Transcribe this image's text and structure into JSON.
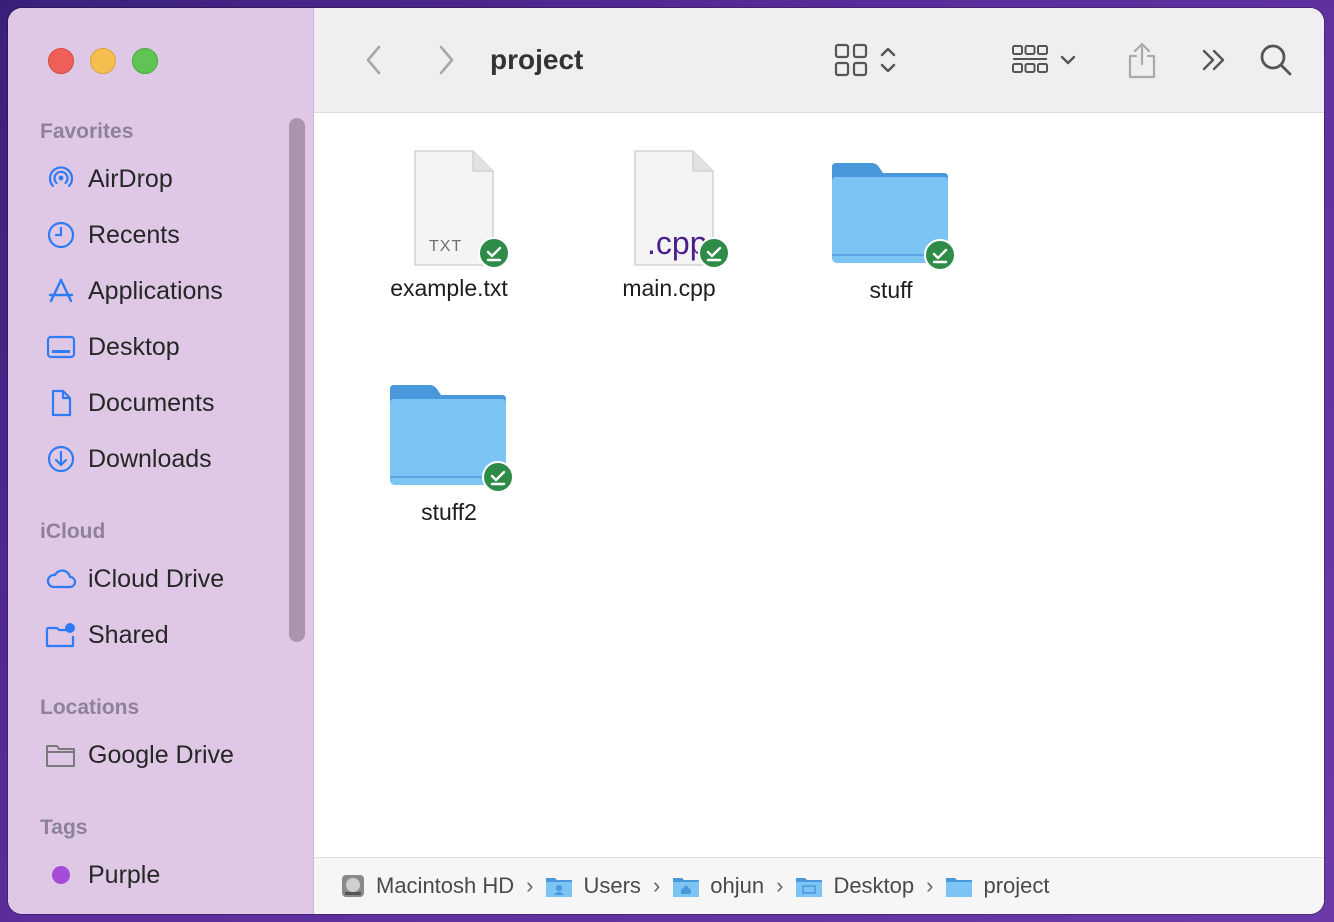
{
  "window": {
    "title": "project"
  },
  "sidebar": {
    "sections": [
      {
        "title": "Favorites"
      },
      {
        "title": "iCloud"
      },
      {
        "title": "Locations"
      },
      {
        "title": "Tags"
      }
    ],
    "favorites": [
      {
        "label": "AirDrop",
        "icon": "airdrop-icon"
      },
      {
        "label": "Recents",
        "icon": "clock-icon"
      },
      {
        "label": "Applications",
        "icon": "applications-icon"
      },
      {
        "label": "Desktop",
        "icon": "desktop-icon"
      },
      {
        "label": "Documents",
        "icon": "document-icon"
      },
      {
        "label": "Downloads",
        "icon": "download-icon"
      }
    ],
    "icloud": [
      {
        "label": "iCloud Drive",
        "icon": "cloud-icon"
      },
      {
        "label": "Shared",
        "icon": "shared-folder-icon"
      }
    ],
    "locations": [
      {
        "label": "Google Drive",
        "icon": "folder-outline-icon"
      }
    ],
    "tags": [
      {
        "label": "Purple",
        "color": "#a64ad8"
      }
    ]
  },
  "files": [
    {
      "name": "example.txt",
      "type": "txt",
      "badge": "TXT",
      "status": "synced"
    },
    {
      "name": "main.cpp",
      "type": "cpp",
      "badge": ".cpp",
      "status": "synced"
    },
    {
      "name": "stuff",
      "type": "folder",
      "status": "synced"
    },
    {
      "name": "stuff2",
      "type": "folder",
      "status": "synced"
    }
  ],
  "pathbar": {
    "crumbs": [
      "Macintosh HD",
      "Users",
      "ohjun",
      "Desktop",
      "project"
    ],
    "separator": "›"
  },
  "colors": {
    "accent": "#2f7bf5",
    "folder": "#6fb7ee",
    "sync_badge": "#2e8b48"
  }
}
